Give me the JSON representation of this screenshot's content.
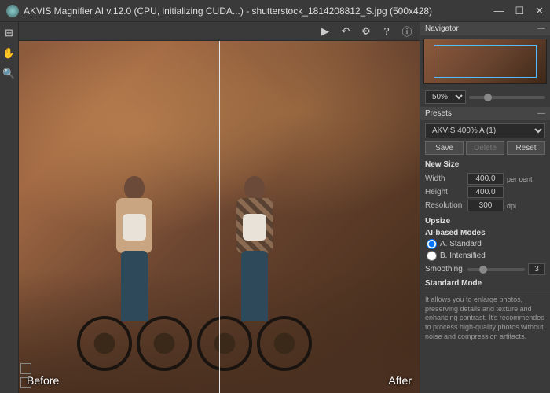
{
  "title": "AKVIS Magnifier AI v.12.0 (CPU, initializing CUDA...) - shutterstock_1814208812_S.jpg (500x428)",
  "window": {
    "min": "—",
    "max": "☐",
    "close": "✕"
  },
  "left_tools": {
    "nav": "⊞",
    "hand": "✋",
    "zoom": "🔍"
  },
  "top_tools": {
    "play": "▶",
    "undo": "↶",
    "settings": "⚙",
    "help": "?",
    "info": "ⓘ"
  },
  "canvas": {
    "before": "Before",
    "after": "After"
  },
  "navigator": {
    "title": "Navigator",
    "zoom": "50%"
  },
  "presets": {
    "title": "Presets",
    "selected": "AKVIS 400% A (1)",
    "save": "Save",
    "delete": "Delete",
    "reset": "Reset"
  },
  "newsize": {
    "title": "New Size",
    "width_lbl": "Width",
    "width": "400.0",
    "height_lbl": "Height",
    "height": "400.0",
    "unit": "per cent",
    "res_lbl": "Resolution",
    "res": "300",
    "res_unit": "dpi",
    "upsize": "Upsize"
  },
  "modes": {
    "title": "AI-based Modes",
    "a": "A. Standard",
    "b": "B. Intensified",
    "smoothing_lbl": "Smoothing",
    "smoothing": "3"
  },
  "standard": {
    "title": "Standard Mode",
    "desc": "It allows you to enlarge photos, preserving details and texture and enhancing contrast. It's recommended to process high-quality photos without noise and compression artifacts."
  }
}
